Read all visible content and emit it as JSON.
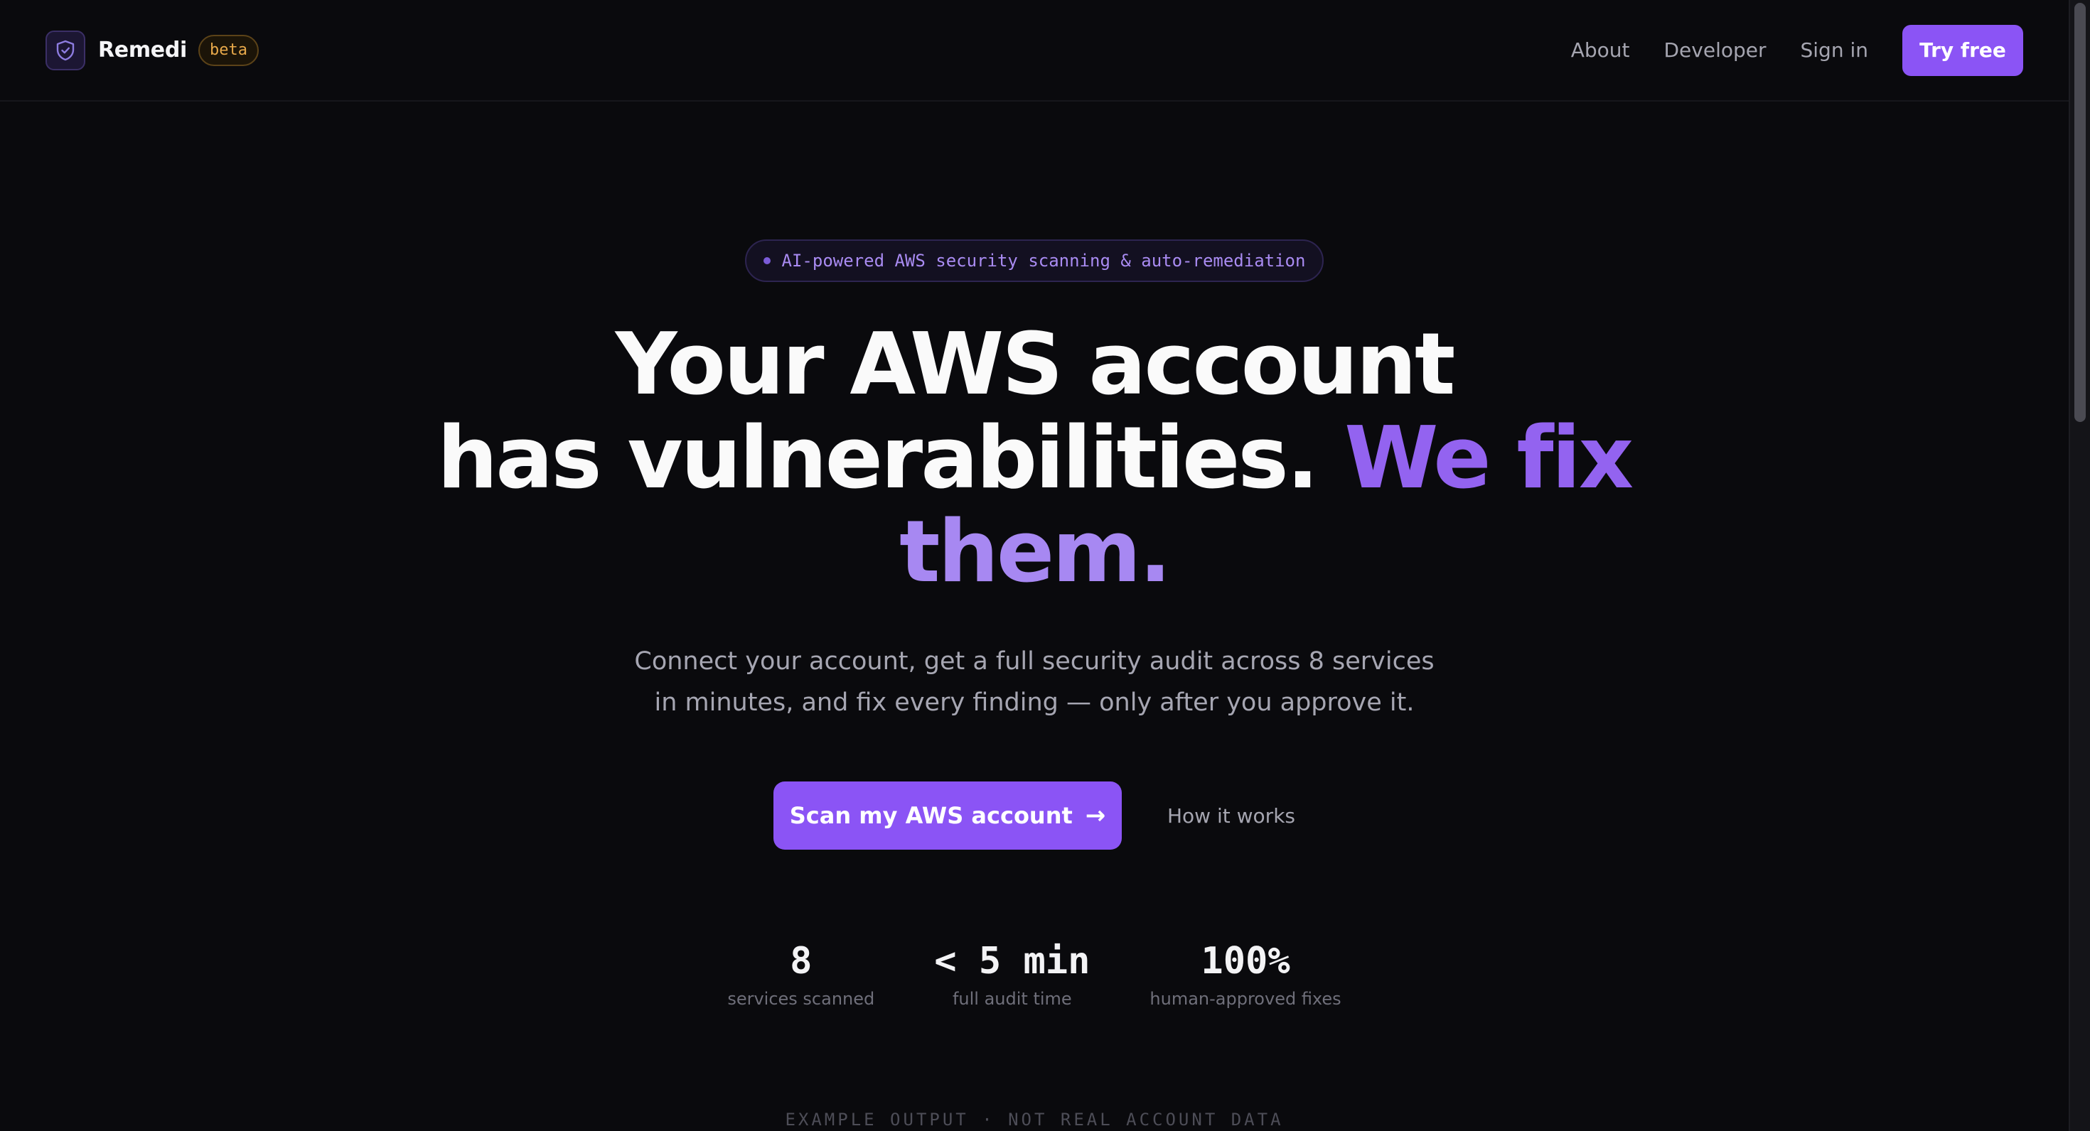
{
  "nav": {
    "brand": "Remedi",
    "badge": "beta",
    "links": [
      "About",
      "Developer",
      "Sign in"
    ],
    "cta": "Try free"
  },
  "hero": {
    "pill": "AI-powered AWS security scanning & auto-remediation",
    "headline": {
      "line1": "Your AWS account",
      "line2": "has vulnerabilities.",
      "accent1": "We fix",
      "accent2": "them."
    },
    "subtitle": {
      "line1": "Connect your account, get a full security audit across 8 services",
      "line2": "in minutes, and fix every finding — only after you approve it."
    },
    "primary_cta": "Scan my AWS account",
    "primary_cta_icon": "arrow-right-icon",
    "secondary_cta": "How it works"
  },
  "stats": [
    {
      "value": "8",
      "label": "services scanned"
    },
    {
      "value": "< 5 min",
      "label": "full audit time"
    },
    {
      "value": "100%",
      "label": "human-approved fixes"
    }
  ],
  "example_note": "EXAMPLE OUTPUT · NOT REAL ACCOUNT DATA",
  "colors": {
    "background": "#0a0a0d",
    "accent": "#8b54f5",
    "badge": "#e8a94a"
  }
}
